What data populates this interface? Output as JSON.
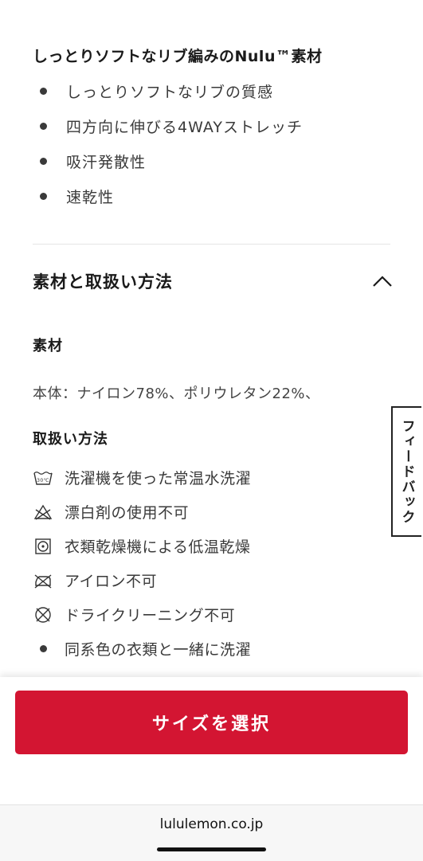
{
  "features": {
    "title": "しっとりソフトなリブ編みのNulu™素材",
    "items": [
      "しっとりソフトなリブの質感",
      "四方向に伸びる4WAYストレッチ",
      "吸汗発散性",
      "速乾性"
    ]
  },
  "accordion": {
    "title": "素材と取扱い方法",
    "icon": "chevron-up-icon",
    "material_heading": "素材",
    "material_text": "本体：ナイロン78%、ポリウレタン22%、",
    "care_heading": "取扱い方法",
    "care_items": [
      {
        "icon": "wash-30-icon",
        "label": "洗濯機を使った常温水洗濯",
        "wash_temp": "30℃"
      },
      {
        "icon": "no-bleach-icon",
        "label": "漂白剤の使用不可"
      },
      {
        "icon": "tumble-dry-low-icon",
        "label": "衣類乾燥機による低温乾燥"
      },
      {
        "icon": "no-iron-icon",
        "label": "アイロン不可"
      },
      {
        "icon": "no-dry-clean-icon",
        "label": "ドライクリーニング不可"
      },
      {
        "icon": "bullet",
        "label": "同系色の衣類と一緒に洗濯"
      }
    ]
  },
  "feedback_tab": {
    "label": "フィードバック"
  },
  "cta": {
    "label": "サイズを選択",
    "color": "#d31532"
  },
  "browser": {
    "url": "lululemon.co.jp"
  }
}
